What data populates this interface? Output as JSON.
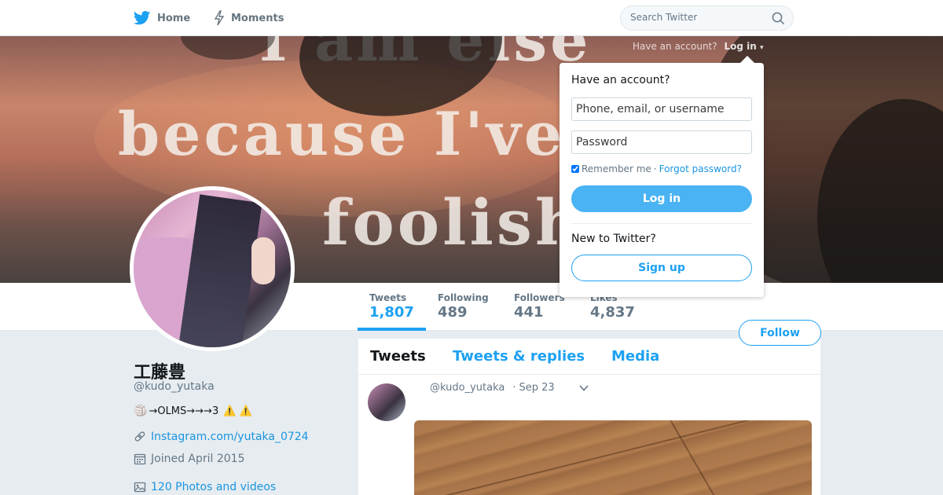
{
  "nav": {
    "home_label": "Home",
    "moments_label": "Moments",
    "search_placeholder": "Search Twitter",
    "brand_color": "#1da1f2"
  },
  "banner": {
    "line1": "I am else",
    "line2": "because I've been",
    "line3": "foolish",
    "have_account_text": "Have an account?",
    "login_link": "Log in",
    "caret": "▾"
  },
  "login_dropdown": {
    "title": "Have an account?",
    "username_placeholder": "Phone, email, or username",
    "password_placeholder": "Password",
    "remember_label": "Remember me",
    "separator": "·",
    "forgot_link": "Forgot password?",
    "login_button": "Log in",
    "new_text": "New to Twitter?",
    "signup_button": "Sign up"
  },
  "stats": [
    {
      "label": "Tweets",
      "value": "1,807",
      "active": true
    },
    {
      "label": "Following",
      "value": "489"
    },
    {
      "label": "Followers",
      "value": "441"
    },
    {
      "label": "Likes",
      "value": "4,837"
    }
  ],
  "follow_button": "Follow",
  "profile": {
    "name": "工藤豊",
    "screen_name": "@kudo_yutaka",
    "bio_emoji": "🏐",
    "bio": "→OLMS→→→3",
    "bio_warn": "⚠️ ⚠️",
    "website": "Instagram.com/yutaka_0724",
    "joined": "Joined April 2015",
    "photos": "120 Photos and videos"
  },
  "timeline": {
    "tabs": [
      "Tweets",
      "Tweets & replies",
      "Media"
    ],
    "tweet": {
      "screen_name": "@kudo_yutaka",
      "separator": "·",
      "date": "Sep 23"
    }
  }
}
